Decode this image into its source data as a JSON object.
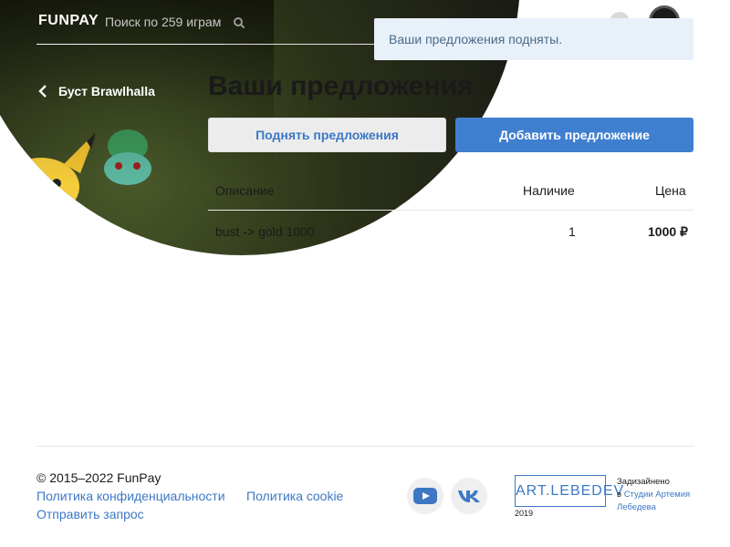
{
  "header": {
    "logo": "FUNPAY",
    "search_placeholder": "Поиск по 259 играм",
    "back_label": "Буст Brawlhalla"
  },
  "toast": {
    "message": "Ваши предложения подняты."
  },
  "main": {
    "title": "Ваши предложения",
    "raise_button": "Поднять предложения",
    "add_button": "Добавить предложение",
    "table": {
      "columns": [
        "Описание",
        "Наличие",
        "Цена"
      ],
      "rows": [
        {
          "description": "bust -> gold 1000",
          "stock": "1",
          "price": "1000 ₽"
        }
      ]
    }
  },
  "footer": {
    "copyright": "© 2015–2022 FunPay",
    "privacy_link": "Политика конфиденциальности",
    "cookie_link": "Политика cookie",
    "request_link": "Отправить запрос",
    "lebedev_logo": "ART.LEBEDEV",
    "lebedev_year": "2019",
    "designed_line1": "Задизайнено",
    "designed_line2_prefix": "в",
    "designed_link1": "Студии Артемия",
    "designed_link2": "Лебедева"
  },
  "colors": {
    "accent": "#3f7fd0",
    "link": "#3d78c5",
    "toast_bg": "#e8f1fa"
  },
  "icons": [
    "search-icon",
    "chevron-left-icon",
    "youtube-icon",
    "vk-icon"
  ]
}
